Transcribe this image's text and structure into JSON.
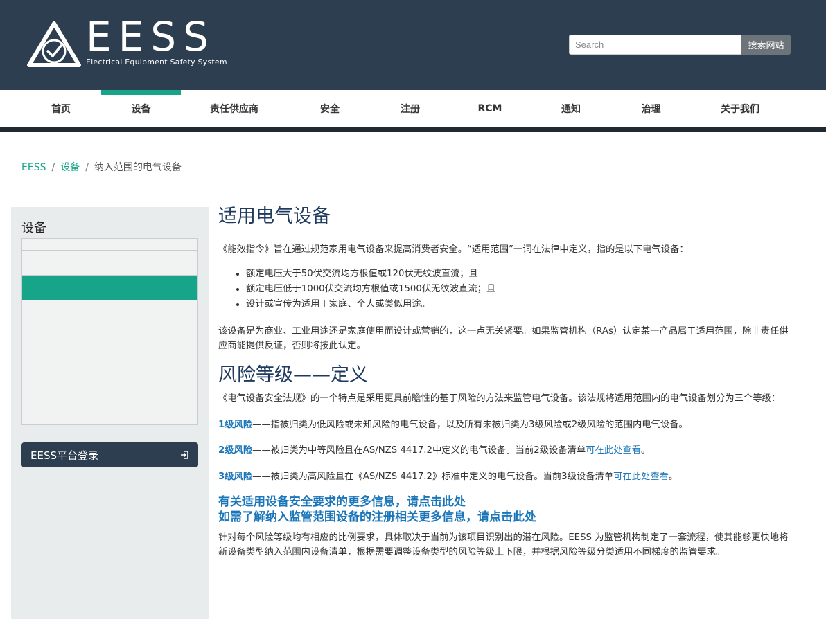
{
  "header": {
    "logo_text": "EESS",
    "logo_tagline": "Electrical Equipment Safety System",
    "search_placeholder": "Search",
    "search_button": "搜索网站",
    "colors": {
      "header_bg": "#2c3e50",
      "accent": "#17a589",
      "link": "#1a76b9"
    }
  },
  "nav": {
    "items": [
      {
        "label": "首页"
      },
      {
        "label": "设备",
        "active": true
      },
      {
        "label": "责任供应商"
      },
      {
        "label": "安全"
      },
      {
        "label": "注册"
      },
      {
        "label": "RCM"
      },
      {
        "label": "通知"
      },
      {
        "label": "治理"
      },
      {
        "label": "关于我们"
      }
    ]
  },
  "breadcrumb": {
    "items": [
      "EESS",
      "设备",
      "纳入范围的电气设备"
    ]
  },
  "sidebar": {
    "title": "设备",
    "login_label": "EESS平台登录",
    "login_icon": "sign-in-icon"
  },
  "main": {
    "title1": "适用电气设备",
    "intro": "《能效指令》旨在通过规范家用电气设备来提高消费者安全。“适用范围”一词在法律中定义，指的是以下电气设备：",
    "bullets": [
      "额定电压大于50伏交流均方根值或120伏无纹波直流；且",
      "额定电压低于1000伏交流均方根值或1500伏无纹波直流；且",
      "设计或宣传为适用于家庭、个人或类似用途。"
    ],
    "para2": "该设备是为商业、工业用途还是家庭使用而设计或营销的，这一点无关紧要。如果监管机构（RAs）认定某一产品属于适用范围，除非责任供应商能提供反证，否则将按此认定。",
    "title2": "风险等级——定义",
    "para3": "《电气设备安全法规》的一个特点是采用更具前瞻性的基于风险的方法来监管电气设备。该法规将适用范围内的电气设备划分为三个等级：",
    "level1_label": "1级风险",
    "level1_text": "——指被归类为低风险或未知风险的电气设备，以及所有未被归类为3级风险或2级风险的范围内电气设备。",
    "level2_label": "2级风险",
    "level2_text": "——被归类为中等风险且在AS/NZS 4417.2中定义的电气设备。当前2级设备清单",
    "level2_link": "可在此处查看",
    "level3_label": "3级风险",
    "level3_text": "——被归类为高风险且在《AS/NZS 4417.2》标准中定义的电气设备。当前3级设备清单",
    "level3_link": "可在此处查看",
    "period": "。",
    "link_big1": "有关适用设备安全要求的更多信息，请点击此处",
    "link_big2": "如需了解纳入监管范围设备的注册相关更多信息，请点击此处",
    "para4": "针对每个风险等级均有相应的比例要求，具体取决于当前为该项目识别出的潜在风险。EESS 为监管机构制定了一套流程，使其能够更快地将新设备类型纳入范围内设备清单，根据需要调整设备类型的风险等级上下限，并根据风险等级分类适用不同梯度的监管要求。"
  }
}
